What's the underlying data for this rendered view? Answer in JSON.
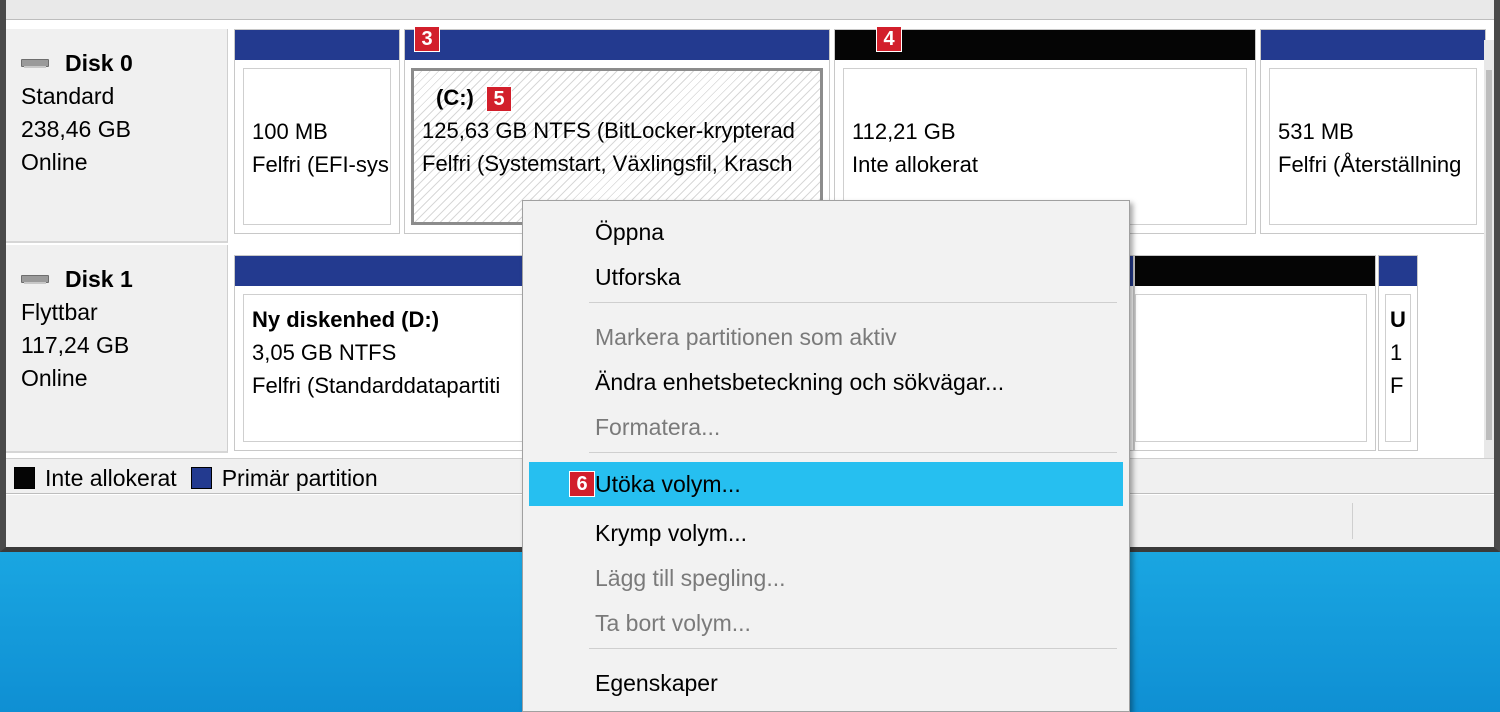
{
  "disks": [
    {
      "name": "Disk 0",
      "type": "Standard",
      "size": "238,46 GB",
      "status": "Online",
      "partitions": [
        {
          "title": "",
          "size": "100 MB",
          "status": "Felfri (EFI-sys"
        },
        {
          "title": "(C:)",
          "size": "125,63 GB NTFS (BitLocker-krypterad",
          "status": "Felfri (Systemstart, Växlingsfil, Krasch"
        },
        {
          "title": "",
          "size": "112,21 GB",
          "status": "Inte allokerat"
        },
        {
          "title": "",
          "size": "531 MB",
          "status": "Felfri (Återställning"
        }
      ]
    },
    {
      "name": "Disk 1",
      "type": "Flyttbar",
      "size": "117,24 GB",
      "status": "Online",
      "partitions": [
        {
          "title": "Ny diskenhed  (D:)",
          "size": "3,05 GB NTFS",
          "status": "Felfri (Standarddatapartiti"
        },
        {
          "title": "",
          "size": "",
          "status": ""
        },
        {
          "title": "U",
          "size": "1",
          "status": "F"
        }
      ]
    }
  ],
  "legend": {
    "unallocated": "Inte allokerat",
    "primary": "Primär partition"
  },
  "badges": {
    "b3": "3",
    "b4": "4",
    "b5": "5",
    "b6": "6"
  },
  "context_menu": {
    "open": "Öppna",
    "explore": "Utforska",
    "mark_active": "Markera partitionen som aktiv",
    "change_letter": "Ändra enhetsbeteckning och sökvägar...",
    "format": "Formatera...",
    "extend": "Utöka volym...",
    "shrink": "Krymp volym...",
    "add_mirror": "Lägg till spegling...",
    "delete": "Ta bort volym...",
    "properties": "Egenskaper"
  },
  "colors": {
    "primary_partition": "#233a8f",
    "unallocated": "#050505",
    "menu_highlight": "#26bff0",
    "badge": "#d21f2b"
  }
}
